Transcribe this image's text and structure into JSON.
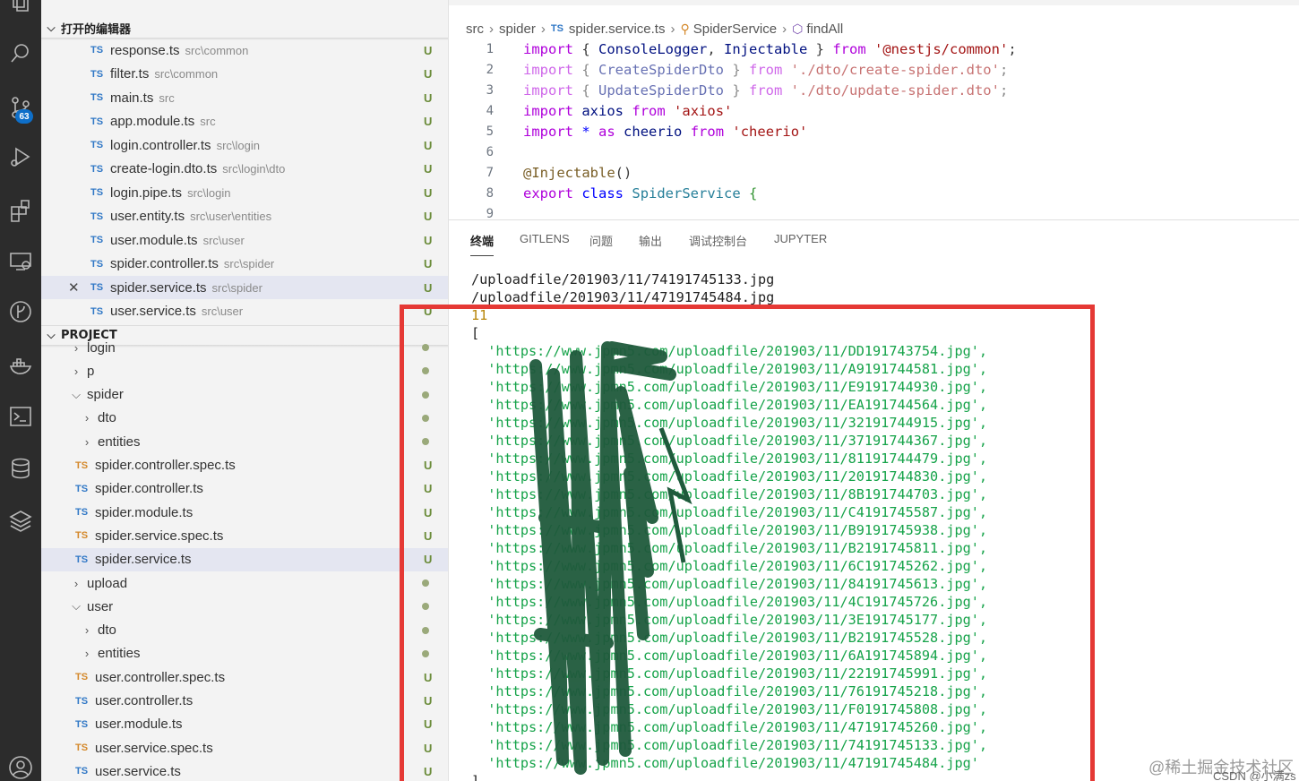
{
  "activity_bar": {
    "icons": [
      "explorer-icon",
      "search-icon",
      "source-control-icon",
      "run-debug-icon",
      "extensions-icon",
      "remote-explorer-icon",
      "gitlens-icon",
      "docker-icon",
      "terminal-icon",
      "database-icon",
      "layers-icon",
      "account-icon"
    ],
    "scm_badge": "63"
  },
  "open_editors": {
    "title": "打开的编辑器",
    "items": [
      {
        "icon": "TS",
        "name": "response.ts",
        "path": "src\\common",
        "status": "U"
      },
      {
        "icon": "TS",
        "name": "filter.ts",
        "path": "src\\common",
        "status": "U"
      },
      {
        "icon": "TS",
        "name": "main.ts",
        "path": "src",
        "status": "U"
      },
      {
        "icon": "TS",
        "name": "app.module.ts",
        "path": "src",
        "status": "U"
      },
      {
        "icon": "TS",
        "name": "login.controller.ts",
        "path": "src\\login",
        "status": "U"
      },
      {
        "icon": "TS",
        "name": "create-login.dto.ts",
        "path": "src\\login\\dto",
        "status": "U"
      },
      {
        "icon": "TS",
        "name": "login.pipe.ts",
        "path": "src\\login",
        "status": "U"
      },
      {
        "icon": "TS",
        "name": "user.entity.ts",
        "path": "src\\user\\entities",
        "status": "U"
      },
      {
        "icon": "TS",
        "name": "user.module.ts",
        "path": "src\\user",
        "status": "U"
      },
      {
        "icon": "TS",
        "name": "spider.controller.ts",
        "path": "src\\spider",
        "status": "U"
      },
      {
        "icon": "TS",
        "name": "spider.service.ts",
        "path": "src\\spider",
        "status": "U",
        "close": "✕"
      },
      {
        "icon": "TS",
        "name": "user.service.ts",
        "path": "src\\user",
        "status": "U"
      }
    ]
  },
  "project": {
    "title": "PROJECT",
    "items": [
      {
        "kind": "folder",
        "open": false,
        "name": "login",
        "indent": 0
      },
      {
        "kind": "folder",
        "open": false,
        "name": "p",
        "indent": 0
      },
      {
        "kind": "folder",
        "open": true,
        "name": "spider",
        "indent": 0
      },
      {
        "kind": "folder",
        "open": false,
        "name": "dto",
        "indent": 1
      },
      {
        "kind": "folder",
        "open": false,
        "name": "entities",
        "indent": 1
      },
      {
        "kind": "file",
        "icon": "TS",
        "spec": true,
        "name": "spider.controller.spec.ts",
        "status": "U"
      },
      {
        "kind": "file",
        "icon": "TS",
        "name": "spider.controller.ts",
        "status": "U"
      },
      {
        "kind": "file",
        "icon": "TS",
        "name": "spider.module.ts",
        "status": "U"
      },
      {
        "kind": "file",
        "icon": "TS",
        "spec": true,
        "name": "spider.service.spec.ts",
        "status": "U"
      },
      {
        "kind": "file",
        "icon": "TS",
        "name": "spider.service.ts",
        "status": "U",
        "selected": true
      },
      {
        "kind": "folder",
        "open": false,
        "name": "upload",
        "indent": 0
      },
      {
        "kind": "folder",
        "open": true,
        "name": "user",
        "indent": 0
      },
      {
        "kind": "folder",
        "open": false,
        "name": "dto",
        "indent": 1
      },
      {
        "kind": "folder",
        "open": false,
        "name": "entities",
        "indent": 1
      },
      {
        "kind": "file",
        "icon": "TS",
        "spec": true,
        "name": "user.controller.spec.ts",
        "status": "U"
      },
      {
        "kind": "file",
        "icon": "TS",
        "name": "user.controller.ts",
        "status": "U"
      },
      {
        "kind": "file",
        "icon": "TS",
        "name": "user.module.ts",
        "status": "U"
      },
      {
        "kind": "file",
        "icon": "TS",
        "spec": true,
        "name": "user.service.spec.ts",
        "status": "U"
      },
      {
        "kind": "file",
        "icon": "TS",
        "name": "user.service.ts",
        "status": "U"
      }
    ]
  },
  "breadcrumb": {
    "parts": [
      "src",
      "spider",
      "spider.service.ts",
      "SpiderService",
      "findAll"
    ],
    "ts_icon": "TS"
  },
  "editor": {
    "lines": [
      {
        "n": "1",
        "tokens": [
          [
            "kw",
            "import"
          ],
          [
            "punc",
            " { "
          ],
          [
            "id",
            "ConsoleLogger"
          ],
          [
            "punc",
            ", "
          ],
          [
            "id",
            "Injectable"
          ],
          [
            "punc",
            " } "
          ],
          [
            "kw",
            "from"
          ],
          [
            "punc",
            " "
          ],
          [
            "str",
            "'@nestjs/common'"
          ],
          [
            "punc",
            ";"
          ]
        ]
      },
      {
        "n": "2",
        "tokens": [
          [
            "kw",
            "import"
          ],
          [
            "punc",
            " { "
          ],
          [
            "id",
            "CreateSpiderDto"
          ],
          [
            "punc",
            " } "
          ],
          [
            "kw",
            "from"
          ],
          [
            "punc",
            " "
          ],
          [
            "str",
            "'./dto/create-spider.dto'"
          ],
          [
            "punc",
            ";"
          ]
        ],
        "faded": true
      },
      {
        "n": "3",
        "tokens": [
          [
            "kw",
            "import"
          ],
          [
            "punc",
            " { "
          ],
          [
            "id",
            "UpdateSpiderDto"
          ],
          [
            "punc",
            " } "
          ],
          [
            "kw",
            "from"
          ],
          [
            "punc",
            " "
          ],
          [
            "str",
            "'./dto/update-spider.dto'"
          ],
          [
            "punc",
            ";"
          ]
        ],
        "faded": true
      },
      {
        "n": "4",
        "tokens": [
          [
            "kw",
            "import"
          ],
          [
            "punc",
            " "
          ],
          [
            "id",
            "axios"
          ],
          [
            "punc",
            " "
          ],
          [
            "kw",
            "from"
          ],
          [
            "punc",
            " "
          ],
          [
            "str",
            "'axios'"
          ]
        ]
      },
      {
        "n": "5",
        "tokens": [
          [
            "kw",
            "import"
          ],
          [
            "punc",
            " "
          ],
          [
            "kw2",
            "*"
          ],
          [
            "punc",
            " "
          ],
          [
            "kw",
            "as"
          ],
          [
            "punc",
            " "
          ],
          [
            "id",
            "cheerio"
          ],
          [
            "punc",
            " "
          ],
          [
            "kw",
            "from"
          ],
          [
            "punc",
            " "
          ],
          [
            "str",
            "'cheerio'"
          ]
        ]
      },
      {
        "n": "6",
        "tokens": []
      },
      {
        "n": "7",
        "tokens": [
          [
            "fn",
            "@Injectable"
          ],
          [
            "punc",
            "()"
          ]
        ]
      },
      {
        "n": "8",
        "tokens": [
          [
            "kw",
            "export"
          ],
          [
            "punc",
            " "
          ],
          [
            "kw2",
            "class"
          ],
          [
            "punc",
            " "
          ],
          [
            "cls",
            "SpiderService"
          ],
          [
            "punc",
            " "
          ],
          [
            "brk",
            "{"
          ]
        ]
      },
      {
        "n": "9",
        "tokens": []
      }
    ]
  },
  "panel": {
    "tabs": [
      "终端",
      "GITLENS",
      "问题",
      "输出",
      "调试控制台",
      "JUPYTER"
    ],
    "active_tab": 0,
    "terminal_lines": [
      {
        "text": "/uploadfile/201903/11/74191745133.jpg",
        "kind": "plain"
      },
      {
        "text": "/uploadfile/201903/11/47191745484.jpg",
        "kind": "plain"
      },
      {
        "text": "11",
        "kind": "num"
      },
      {
        "text": "[",
        "kind": "plain"
      },
      {
        "text": "  'https://www.jpmn5.com/uploadfile/201903/11/DD191743754.jpg',",
        "kind": "url"
      },
      {
        "text": "  'https://www.jpmn5.com/uploadfile/201903/11/A9191744581.jpg',",
        "kind": "url"
      },
      {
        "text": "  'https://www.jpmn5.com/uploadfile/201903/11/E9191744930.jpg',",
        "kind": "url"
      },
      {
        "text": "  'https://www.jpmn5.com/uploadfile/201903/11/EA191744564.jpg',",
        "kind": "url"
      },
      {
        "text": "  'https://www.jpmn5.com/uploadfile/201903/11/32191744915.jpg',",
        "kind": "url"
      },
      {
        "text": "  'https://www.jpmn5.com/uploadfile/201903/11/37191744367.jpg',",
        "kind": "url"
      },
      {
        "text": "  'https://www.jpmn5.com/uploadfile/201903/11/81191744479.jpg',",
        "kind": "url"
      },
      {
        "text": "  'https://www.jpmn5.com/uploadfile/201903/11/20191744830.jpg',",
        "kind": "url"
      },
      {
        "text": "  'https://www.jpmn5.com/uploadfile/201903/11/8B191744703.jpg',",
        "kind": "url"
      },
      {
        "text": "  'https://www.jpmn5.com/uploadfile/201903/11/C4191745587.jpg',",
        "kind": "url"
      },
      {
        "text": "  'https://www.jpmn5.com/uploadfile/201903/11/B9191745938.jpg',",
        "kind": "url"
      },
      {
        "text": "  'https://www.jpmn5.com/uploadfile/201903/11/B2191745811.jpg',",
        "kind": "url"
      },
      {
        "text": "  'https://www.jpmn5.com/uploadfile/201903/11/6C191745262.jpg',",
        "kind": "url"
      },
      {
        "text": "  'https://www.jpmn5.com/uploadfile/201903/11/84191745613.jpg',",
        "kind": "url"
      },
      {
        "text": "  'https://www.jpmn5.com/uploadfile/201903/11/4C191745726.jpg',",
        "kind": "url"
      },
      {
        "text": "  'https://www.jpmn5.com/uploadfile/201903/11/3E191745177.jpg',",
        "kind": "url"
      },
      {
        "text": "  'https://www.jpmn5.com/uploadfile/201903/11/B2191745528.jpg',",
        "kind": "url"
      },
      {
        "text": "  'https://www.jpmn5.com/uploadfile/201903/11/6A191745894.jpg',",
        "kind": "url"
      },
      {
        "text": "  'https://www.jpmn5.com/uploadfile/201903/11/22191745991.jpg',",
        "kind": "url"
      },
      {
        "text": "  'https://www.jpmn5.com/uploadfile/201903/11/76191745218.jpg',",
        "kind": "url"
      },
      {
        "text": "  'https://www.jpmn5.com/uploadfile/201903/11/F0191745808.jpg',",
        "kind": "url"
      },
      {
        "text": "  'https://www.jpmn5.com/uploadfile/201903/11/47191745260.jpg',",
        "kind": "url"
      },
      {
        "text": "  'https://www.jpmn5.com/uploadfile/201903/11/74191745133.jpg',",
        "kind": "url"
      },
      {
        "text": "  'https://www.jpmn5.com/uploadfile/201903/11/47191745484.jpg'",
        "kind": "url"
      },
      {
        "text": "]",
        "kind": "plain"
      }
    ]
  },
  "watermarks": {
    "juejin": "@稀土掘金技术社区",
    "csdn": "CSDN @小满zs"
  },
  "colors": {
    "activity_bar": "#2c2c2c",
    "sidebar": "#f3f3f3",
    "ts_blue": "#3178c6",
    "terminal_url": "#16a34a",
    "highlight_box": "#e53935",
    "scribble": "#1f5a3c"
  }
}
